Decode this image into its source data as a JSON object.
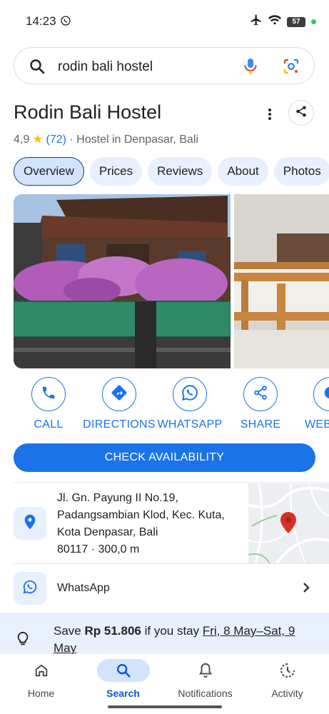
{
  "status_bar": {
    "time": "14:23",
    "battery": "57"
  },
  "search": {
    "query": "rodin bali hostel"
  },
  "place": {
    "name": "Rodin Bali Hostel",
    "rating": "4,9",
    "review_count": "(72)",
    "category": "· Hostel in Denpasar, Bali"
  },
  "tabs": [
    "Overview",
    "Prices",
    "Reviews",
    "About",
    "Photos"
  ],
  "actions": {
    "call": "CALL",
    "directions": "DIRECTIONS",
    "whatsapp": "WHATSAPP",
    "share": "SHARE",
    "website": "WEB"
  },
  "check_availability": "CHECK AVAILABILITY",
  "address": {
    "line1": "Jl. Gn. Payung II No.19,",
    "line2": "Padangsambian Klod, Kec. Kuta,",
    "line3": "Kota Denpasar, Bali",
    "line4": "80117 · 300,0 m"
  },
  "whatsapp_row": {
    "label": "WhatsApp"
  },
  "save_banner": {
    "prefix": "Save ",
    "amount": "Rp 51.806",
    "middle": " if you stay ",
    "dates": "Fri, 8 May–Sat, 9 May"
  },
  "bottom_nav": [
    "Home",
    "Search",
    "Notifications",
    "Activity"
  ],
  "colors": {
    "accent": "#1a73e8",
    "tab_bg": "#e8f0fe",
    "pin": "#d93025"
  }
}
